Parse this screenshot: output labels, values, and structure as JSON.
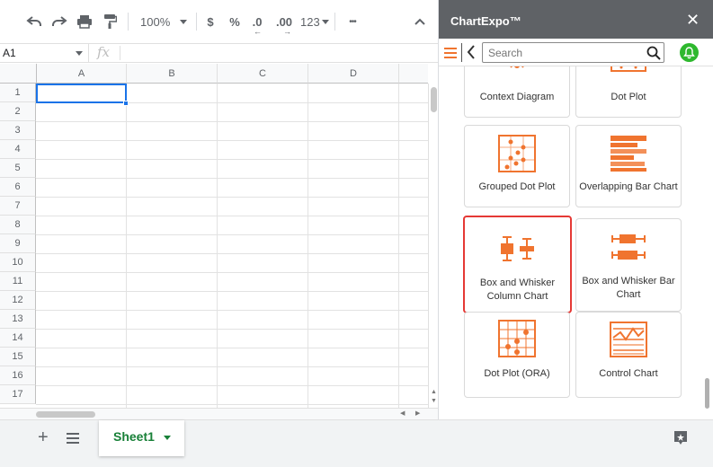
{
  "toolbar": {
    "zoom": "100%",
    "currency_label": "$",
    "percent_label": "%",
    "decrease_decimal_label": ".0",
    "increase_decimal_label": ".00",
    "format_label": "123",
    "more_label": "•••"
  },
  "formula_bar": {
    "cell_ref": "A1",
    "fx_label": "fx"
  },
  "grid": {
    "columns": [
      "A",
      "B",
      "C",
      "D"
    ],
    "rows": [
      "1",
      "2",
      "3",
      "4",
      "5",
      "6",
      "7",
      "8",
      "9",
      "10",
      "11",
      "12",
      "13",
      "14",
      "15",
      "16",
      "17"
    ]
  },
  "sheets": {
    "add_label": "+",
    "active_sheet": "Sheet1"
  },
  "panel": {
    "title": "ChartExpo™",
    "close_label": "✕",
    "search_placeholder": "Search",
    "accent_color": "#f0742f",
    "charts": [
      {
        "label": "Context Diagram",
        "icon": "context-diagram-icon"
      },
      {
        "label": "Dot Plot",
        "icon": "dot-plot-icon"
      },
      {
        "label": "Grouped Dot Plot",
        "icon": "grouped-dot-plot-icon"
      },
      {
        "label": "Overlapping Bar Chart",
        "icon": "overlapping-bar-chart-icon"
      },
      {
        "label": "Box and Whisker Column Chart",
        "icon": "box-whisker-column-icon",
        "selected": true
      },
      {
        "label": "Box and Whisker Bar Chart",
        "icon": "box-whisker-bar-icon"
      },
      {
        "label": "Dot Plot (ORA)",
        "icon": "dot-plot-ora-icon"
      },
      {
        "label": "Control Chart",
        "icon": "control-chart-icon"
      }
    ]
  }
}
